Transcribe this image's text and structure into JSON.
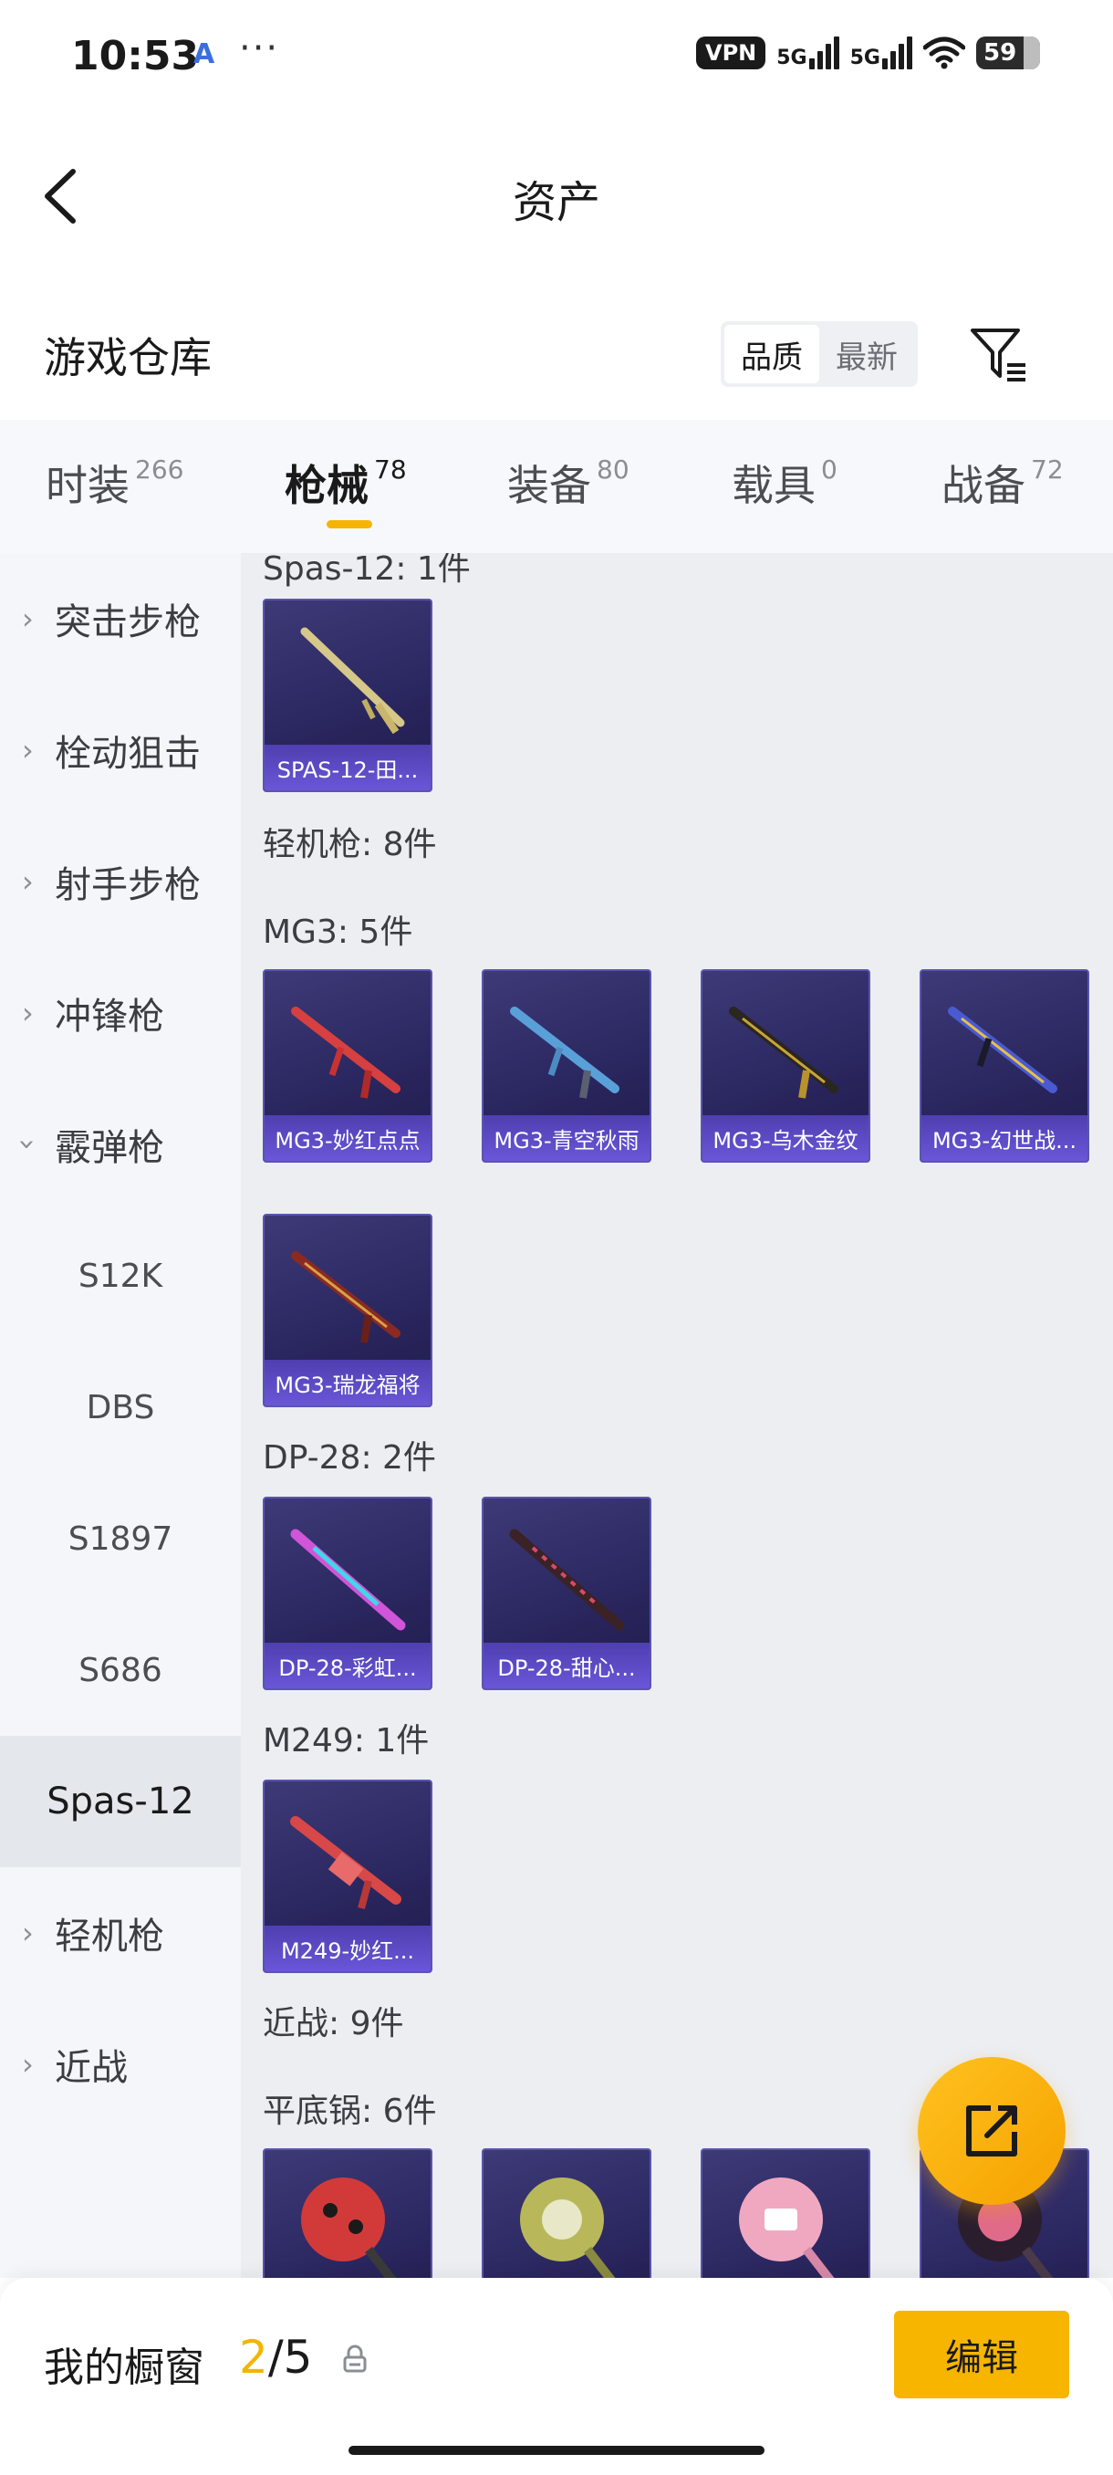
{
  "status_bar": {
    "time": "10:53",
    "app_icon": "A",
    "dots": "···",
    "vpn": "VPN",
    "signal1": "5G",
    "signal2": "5G",
    "battery": "59"
  },
  "nav": {
    "title": "资产",
    "back_icon": "chevron-left-icon"
  },
  "warehouse": {
    "title": "游戏仓库",
    "sort_options": [
      "品质",
      "最新"
    ],
    "sort_active": "品质",
    "filter_icon": "filter-icon"
  },
  "tabs": [
    {
      "label": "时装",
      "count": "266"
    },
    {
      "label": "枪械",
      "count": "78",
      "active": true
    },
    {
      "label": "装备",
      "count": "80"
    },
    {
      "label": "载具",
      "count": "0"
    },
    {
      "label": "战备",
      "count": "72"
    }
  ],
  "sidebar": {
    "categories": [
      {
        "label": "突击步枪"
      },
      {
        "label": "栓动狙击"
      },
      {
        "label": "射手步枪"
      },
      {
        "label": "冲锋枪"
      },
      {
        "label": "霰弹枪",
        "expanded": true
      },
      {
        "label": "轻机枪"
      },
      {
        "label": "近战"
      }
    ],
    "sub_items": [
      {
        "label": "S12K"
      },
      {
        "label": "DBS"
      },
      {
        "label": "S1897"
      },
      {
        "label": "S686"
      },
      {
        "label": "Spas-12",
        "active": true
      }
    ]
  },
  "content": {
    "groups": {
      "spas_header": "Spas-12: 1件",
      "lmg_header": "轻机枪: 8件",
      "mg3_header": "MG3: 5件",
      "dp28_header": "DP-28: 2件",
      "m249_header": "M249: 1件",
      "melee_header": "近战: 9件",
      "pan_header": "平底锅: 6件"
    },
    "items": {
      "spas": "SPAS-12-田...",
      "mg3_1": "MG3-妙红点点",
      "mg3_2": "MG3-青空秋雨",
      "mg3_3": "MG3-乌木金纹",
      "mg3_4": "MG3-幻世战...",
      "mg3_5": "MG3-瑞龙福将",
      "dp_1": "DP-28-彩虹...",
      "dp_2": "DP-28-甜心...",
      "m249": "M249-妙红..."
    },
    "colors": {
      "accent": "#f5b400",
      "card_bg": "#2b2760",
      "card_caption": "#6a56d8"
    }
  },
  "fab": {
    "icon": "share-external-icon"
  },
  "bottom": {
    "label": "我的橱窗",
    "current": "2",
    "total": "/5",
    "lock_icon": "lock-icon",
    "edit_label": "编辑"
  }
}
